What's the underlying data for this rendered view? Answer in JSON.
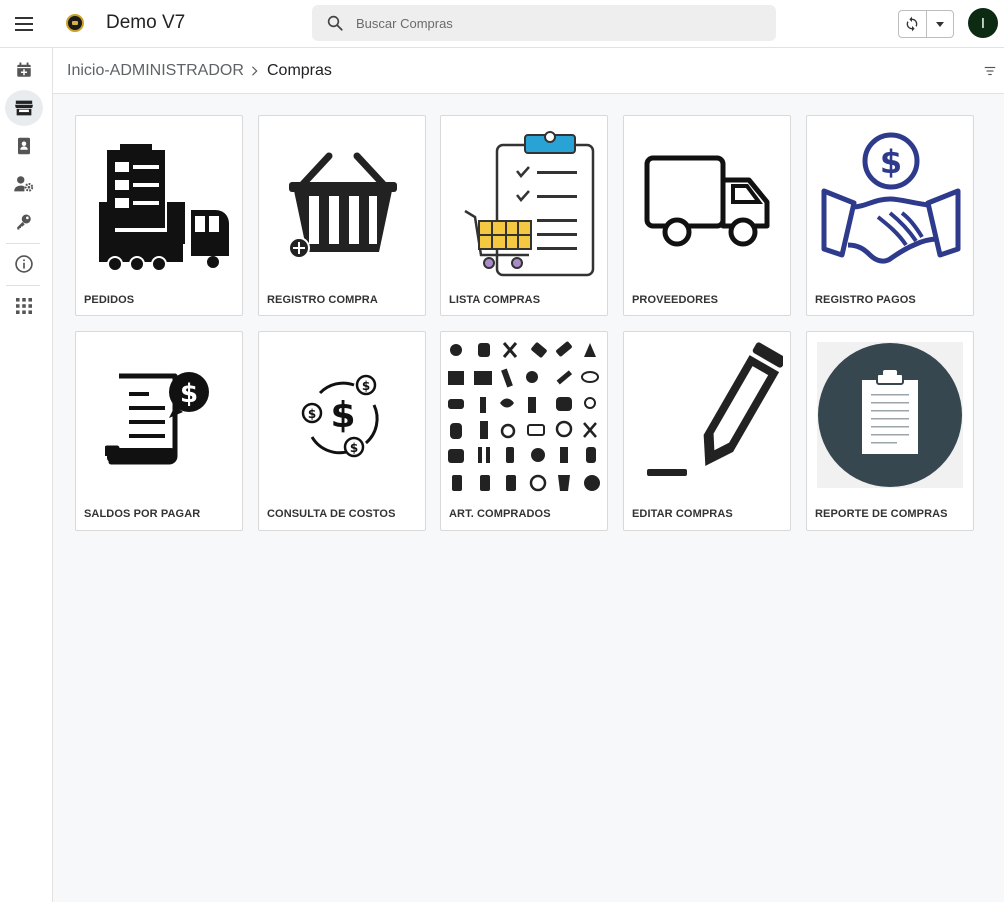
{
  "app": {
    "title": "Demo V7",
    "avatar_initial": "I"
  },
  "search": {
    "placeholder": "Buscar Compras"
  },
  "sidebar": {
    "items": [
      {
        "name": "calendar-add-icon"
      },
      {
        "name": "store-icon",
        "active": true
      },
      {
        "name": "contact-book-icon"
      },
      {
        "name": "user-settings-icon"
      },
      {
        "name": "key-icon"
      },
      {
        "name": "info-icon"
      },
      {
        "name": "apps-grid-icon"
      }
    ]
  },
  "breadcrumb": {
    "home": "Inicio-ADMINISTRADOR",
    "current": "Compras"
  },
  "cards": [
    {
      "label": "PEDIDOS",
      "icon": "orders-truck-icon"
    },
    {
      "label": "REGISTRO COMPRA",
      "icon": "shopping-basket-add-icon"
    },
    {
      "label": "LISTA COMPRAS",
      "icon": "clipboard-checklist-cart-icon"
    },
    {
      "label": "PROVEEDORES",
      "icon": "delivery-truck-icon"
    },
    {
      "label": "REGISTRO PAGOS",
      "icon": "handshake-dollar-icon"
    },
    {
      "label": "SALDOS POR PAGAR",
      "icon": "invoice-dollar-icon"
    },
    {
      "label": "CONSULTA DE COSTOS",
      "icon": "dollar-cycle-icon"
    },
    {
      "label": "ART. COMPRADOS",
      "icon": "cosmetics-grid-icon"
    },
    {
      "label": "EDITAR COMPRAS",
      "icon": "pencil-edit-icon"
    },
    {
      "label": "REPORTE DE COMPRAS",
      "icon": "clipboard-report-icon"
    }
  ],
  "colors": {
    "accent_blue": "#2e3a8c",
    "cart_yellow": "#f5c842",
    "clipboard_blue": "#29a3d6",
    "report_circle": "#37474f"
  }
}
